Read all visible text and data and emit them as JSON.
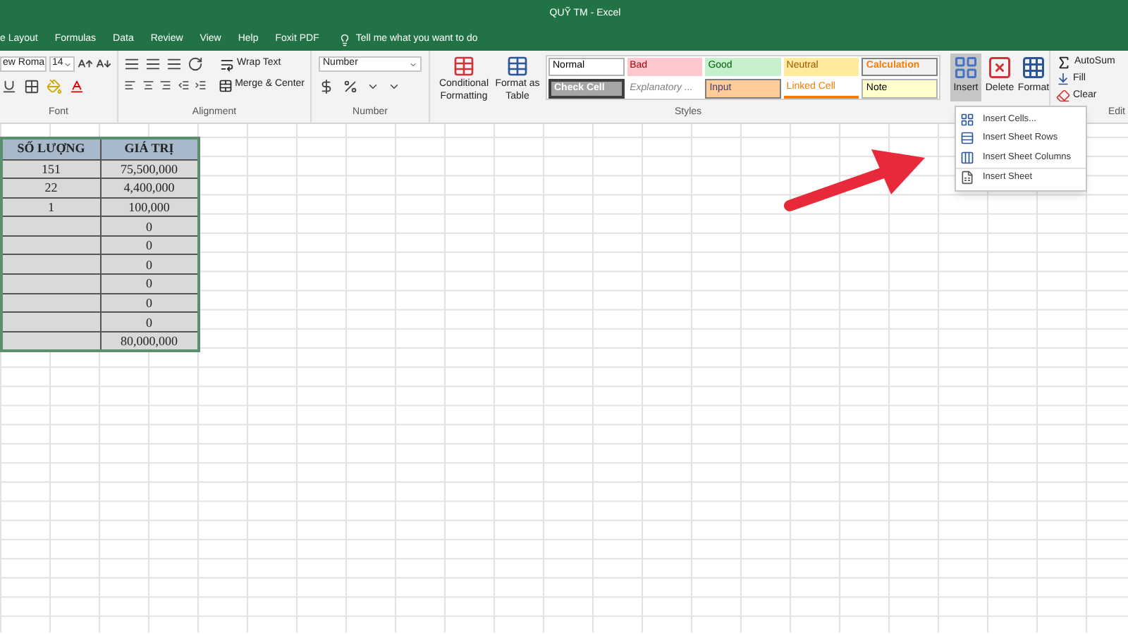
{
  "window": {
    "title": "QUỸ TM  -  Excel"
  },
  "tabs": [
    {
      "label": "e Layout"
    },
    {
      "label": "Formulas"
    },
    {
      "label": "Data"
    },
    {
      "label": "Review"
    },
    {
      "label": "View"
    },
    {
      "label": "Help"
    },
    {
      "label": "Foxit PDF"
    }
  ],
  "tell_me": {
    "placeholder": "Tell me what you want to do"
  },
  "ribbon": {
    "font": {
      "name": "ew Roma",
      "size": "14",
      "label": "Font"
    },
    "alignment": {
      "wrap_text": "Wrap Text",
      "merge": "Merge & Center",
      "label": "Alignment"
    },
    "number": {
      "format": "Number",
      "label": "Number"
    },
    "formatting": {
      "conditional": [
        "Conditional",
        "Formatting"
      ],
      "format_as_table": [
        "Format as",
        "Table"
      ]
    },
    "styles": {
      "label": "Styles",
      "items": [
        {
          "label": "Normal",
          "kind": "normal"
        },
        {
          "label": "Bad",
          "kind": "bad"
        },
        {
          "label": "Good",
          "kind": "good"
        },
        {
          "label": "Neutral",
          "kind": "neutral"
        },
        {
          "label": "Calculation",
          "kind": "calculation"
        },
        {
          "label": "Check Cell",
          "kind": "check"
        },
        {
          "label": "Explanatory ...",
          "kind": "explanatory"
        },
        {
          "label": "Input",
          "kind": "input"
        },
        {
          "label": "Linked Cell",
          "kind": "linked"
        },
        {
          "label": "Note",
          "kind": "note"
        }
      ]
    },
    "cells": [
      {
        "label": "Insert",
        "kind": "insert",
        "selected": true
      },
      {
        "label": "Delete",
        "kind": "delete",
        "selected": false
      },
      {
        "label": "Format",
        "kind": "format",
        "selected": false
      }
    ],
    "editing": {
      "items": [
        {
          "label": "AutoSum",
          "kind": "sum"
        },
        {
          "label": "Fill",
          "kind": "fill"
        },
        {
          "label": "Clear",
          "kind": "clear"
        }
      ],
      "label": "Edit"
    }
  },
  "insert_menu": [
    {
      "label": "Insert Cells...",
      "kind": "cells"
    },
    {
      "label": "Insert Sheet Rows",
      "kind": "rows"
    },
    {
      "label": "Insert Sheet Columns",
      "kind": "columns"
    },
    {
      "label": "Insert Sheet",
      "kind": "sheet"
    }
  ],
  "table": {
    "columns": [
      "SỐ LƯỢNG",
      "GIÁ TRỊ"
    ],
    "rows": [
      [
        "151",
        "75,500,000"
      ],
      [
        "22",
        "4,400,000"
      ],
      [
        "1",
        "100,000"
      ],
      [
        "",
        "0"
      ],
      [
        "",
        "0"
      ],
      [
        "",
        "0"
      ],
      [
        "",
        "0"
      ],
      [
        "",
        "0"
      ],
      [
        "",
        "0"
      ],
      [
        "",
        "80,000,000"
      ]
    ]
  }
}
